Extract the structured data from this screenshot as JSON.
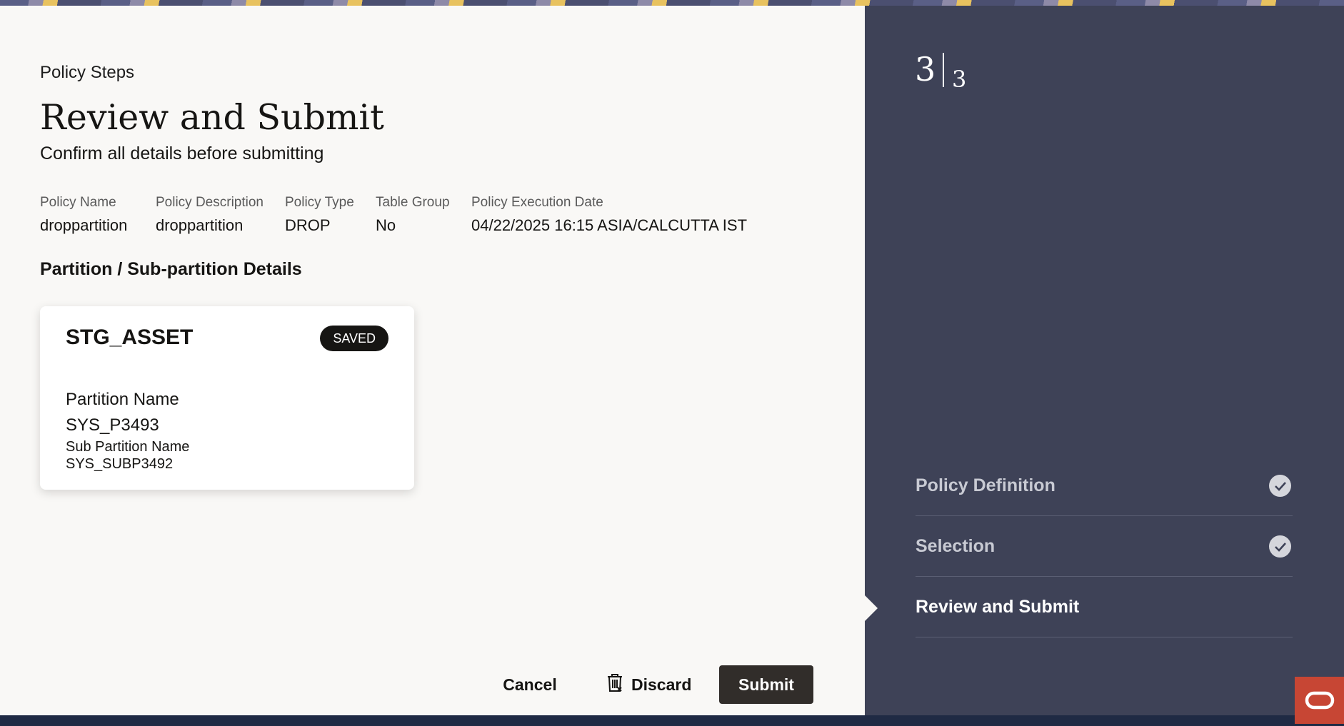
{
  "header": {
    "policy_steps_label": "Policy Steps",
    "title": "Review and Submit",
    "subtitle": "Confirm all details before submitting"
  },
  "summary": [
    {
      "label": "Policy Name",
      "value": "droppartition"
    },
    {
      "label": "Policy Description",
      "value": "droppartition"
    },
    {
      "label": "Policy Type",
      "value": "DROP"
    },
    {
      "label": "Table Group",
      "value": "No"
    },
    {
      "label": "Policy Execution Date",
      "value": "04/22/2025 16:15 ASIA/CALCUTTA IST"
    }
  ],
  "section": {
    "title": "Partition / Sub-partition Details"
  },
  "card": {
    "title": "STG_ASSET",
    "badge": "SAVED",
    "partition_name_label": "Partition Name",
    "partition_name_value": "SYS_P3493",
    "sub_partition_name_label": "Sub Partition Name",
    "sub_partition_name_value": "SYS_SUBP3492"
  },
  "footer": {
    "cancel_label": "Cancel",
    "discard_label": "Discard",
    "submit_label": "Submit"
  },
  "progress": {
    "current": "3",
    "total": "3"
  },
  "steps": [
    {
      "label": "Policy Definition",
      "status": "completed",
      "icon": "check-circle-icon"
    },
    {
      "label": "Selection",
      "status": "completed",
      "icon": "check-circle-icon"
    },
    {
      "label": "Review and Submit",
      "status": "active"
    }
  ],
  "colors": {
    "panel_background": "#3e4257",
    "drawer_background": "#f9f8f6",
    "primary_button": "#312d2a",
    "oracle_red": "#c74634"
  }
}
